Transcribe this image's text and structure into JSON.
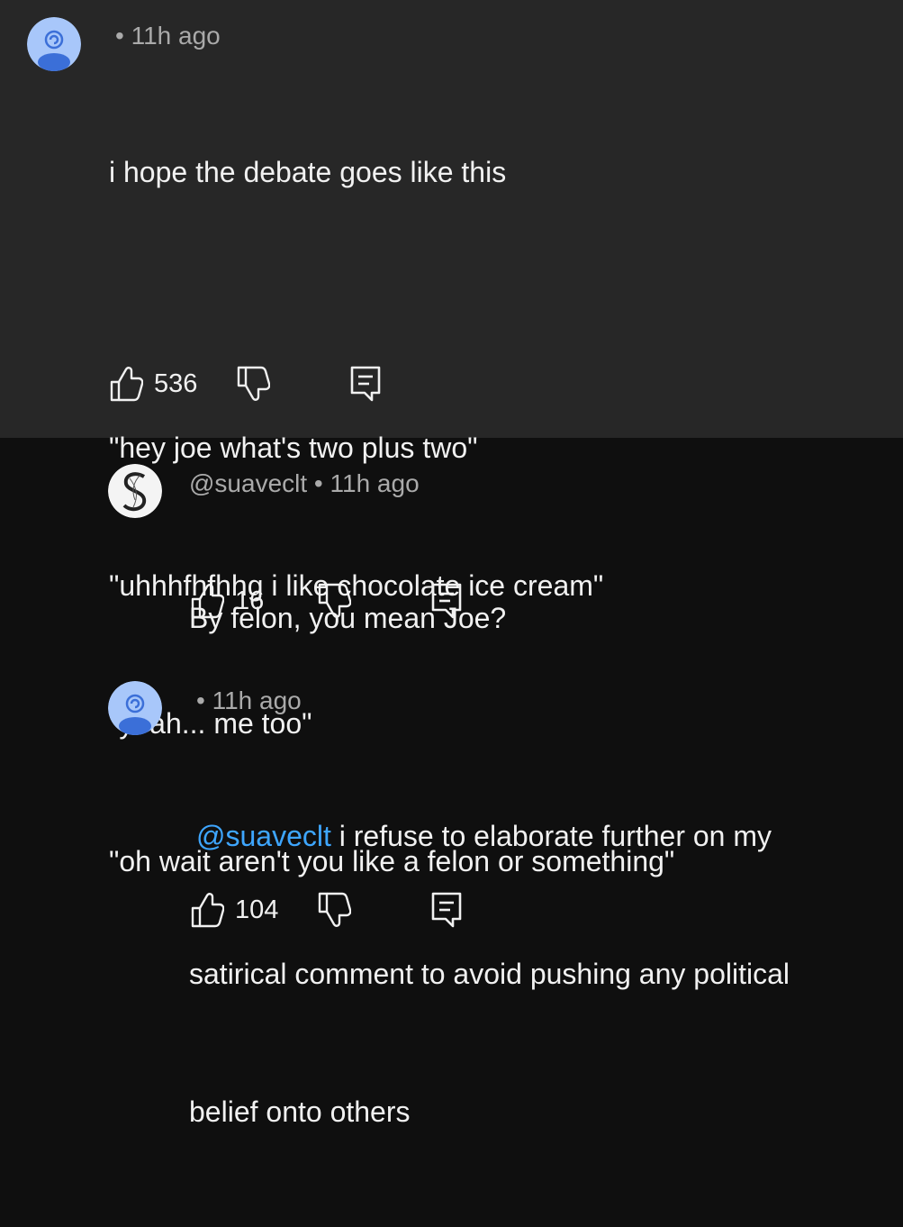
{
  "comments": [
    {
      "author": "",
      "time": "11h ago",
      "separator": "•",
      "lines": [
        "i hope the debate goes like this",
        "",
        "\"hey joe what's two plus two\"",
        "\"uhhhfhfhhg i like chocolate ice cream\"",
        "\"yeah... me too\"",
        "\"oh wait aren't you like a felon or something\""
      ],
      "likes": "536",
      "avatar_icon": "spiral-avatar-icon"
    },
    {
      "author": "@suaveclt",
      "time": "11h ago",
      "separator": "•",
      "lines": [
        "By felon, you mean Joe?"
      ],
      "likes": "16",
      "avatar_icon": "s-logo-avatar-icon"
    },
    {
      "author": "",
      "time": "11h ago",
      "separator": "•",
      "mention": "@suaveclt",
      "text_after_mention": " i refuse to elaborate further on my",
      "lines_rest": [
        "satirical comment to avoid pushing any political",
        "belief onto others"
      ],
      "likes": "104",
      "avatar_icon": "spiral-avatar-icon"
    }
  ],
  "icons": {
    "like": "thumbs-up-icon",
    "dislike": "thumbs-down-icon",
    "reply": "reply-icon"
  },
  "colors": {
    "highlight_bg": "#272727",
    "page_bg": "#0f0f0f",
    "mention": "#3ea6ff",
    "avatar_blue": "#a8c7fa",
    "avatar_dark_blue": "#3b6fd8"
  }
}
